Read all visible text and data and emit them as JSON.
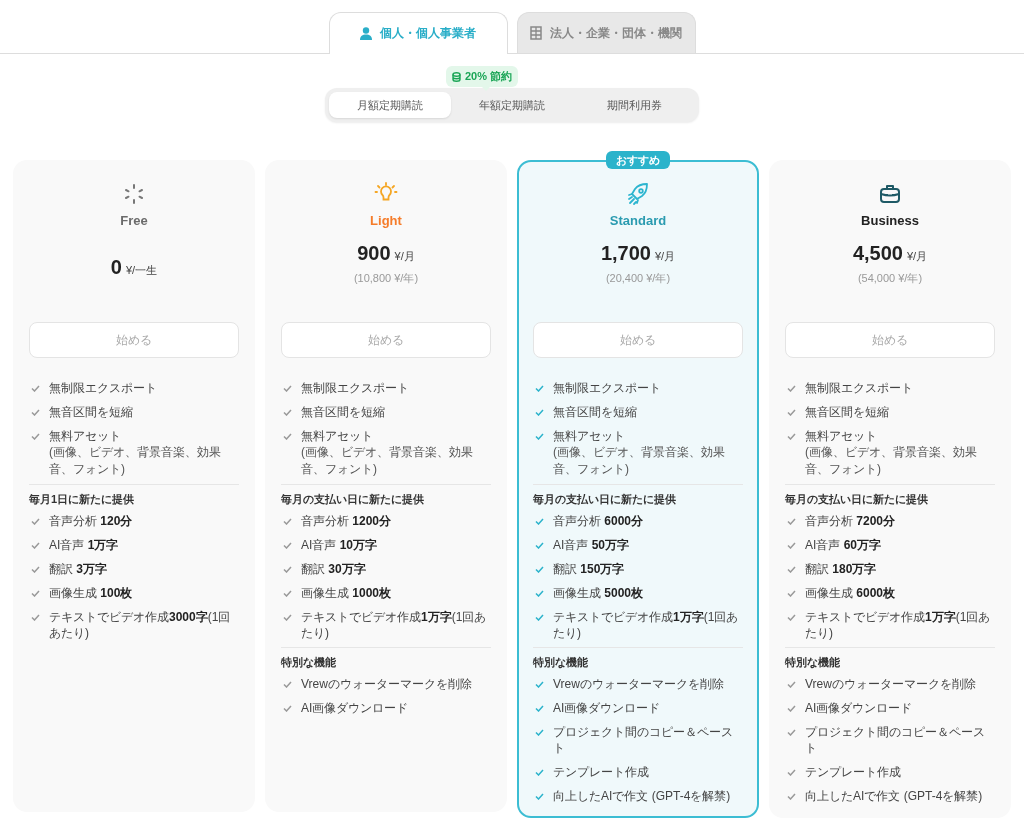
{
  "account_tabs": [
    {
      "label": "個人・個人事業者",
      "selected": true
    },
    {
      "label": "法人・企業・団体・機関",
      "selected": false
    }
  ],
  "billing": {
    "badge": "20% 節約",
    "options": [
      {
        "label": "月額定期購読",
        "selected": true
      },
      {
        "label": "年額定期購読",
        "selected": false
      },
      {
        "label": "期間利用券",
        "selected": false
      }
    ]
  },
  "plans": [
    {
      "name": "Free",
      "color": "#6b6b6b",
      "recommended": false,
      "price": "0",
      "unit": "¥/一生",
      "button": "始める",
      "sections": [
        {
          "features": [
            {
              "text": "無制限エクスポート"
            },
            {
              "text": "無音区間を短縮"
            },
            {
              "text": "無料アセット",
              "note": "(画像、ビデオ、背景音楽、効果音、フォント)"
            }
          ]
        },
        {
          "heading": "毎月1日に新たに提供",
          "features": [
            {
              "text": "音声分析 **120分**"
            },
            {
              "text": "AI音声 **1万字**"
            },
            {
              "text": "翻訳 **3万字**"
            },
            {
              "text": "画像生成 **100枚**"
            },
            {
              "text": "テキストでビデオ作成**3000字**(1回あたり)"
            }
          ]
        }
      ]
    },
    {
      "name": "Light",
      "color": "#f57c2a",
      "recommended": false,
      "price": "900",
      "unit": "¥/月",
      "yearly": "(10,800 ¥/年)",
      "button": "始める",
      "sections": [
        {
          "features": [
            {
              "text": "無制限エクスポート"
            },
            {
              "text": "無音区間を短縮"
            },
            {
              "text": "無料アセット",
              "note": "(画像、ビデオ、背景音楽、効果音、フォント)"
            }
          ]
        },
        {
          "heading": "毎月の支払い日に新たに提供",
          "features": [
            {
              "text": "音声分析 **1200分**"
            },
            {
              "text": "AI音声 **10万字**"
            },
            {
              "text": "翻訳 **30万字**"
            },
            {
              "text": "画像生成 **1000枚**"
            },
            {
              "text": "テキストでビデオ作成**1万字**(1回あたり)"
            }
          ]
        },
        {
          "heading": "特別な機能",
          "features": [
            {
              "text": "Vrewのウォーターマークを削除"
            },
            {
              "text": "AI画像ダウンロード"
            }
          ]
        }
      ]
    },
    {
      "name": "Standard",
      "color": "#2a9bb0",
      "recommended": true,
      "badge": "おすすめ",
      "price": "1,700",
      "unit": "¥/月",
      "yearly": "(20,400 ¥/年)",
      "button": "始める",
      "sections": [
        {
          "features": [
            {
              "text": "無制限エクスポート"
            },
            {
              "text": "無音区間を短縮"
            },
            {
              "text": "無料アセット",
              "note": "(画像、ビデオ、背景音楽、効果音、フォント)"
            }
          ]
        },
        {
          "heading": "毎月の支払い日に新たに提供",
          "features": [
            {
              "text": "音声分析 **6000分**"
            },
            {
              "text": "AI音声 **50万字**"
            },
            {
              "text": "翻訳 **150万字**"
            },
            {
              "text": "画像生成 **5000枚**"
            },
            {
              "text": "テキストでビデオ作成**1万字**(1回あたり)"
            }
          ]
        },
        {
          "heading": "特別な機能",
          "features": [
            {
              "text": "Vrewのウォーターマークを削除"
            },
            {
              "text": "AI画像ダウンロード"
            },
            {
              "text": "プロジェクト間のコピー＆ペースト"
            },
            {
              "text": "テンプレート作成"
            },
            {
              "text": "向上したAIで作文 (GPT-4を解禁)"
            }
          ]
        }
      ]
    },
    {
      "name": "Business",
      "color": "#222222",
      "recommended": false,
      "price": "4,500",
      "unit": "¥/月",
      "yearly": "(54,000 ¥/年)",
      "button": "始める",
      "sections": [
        {
          "features": [
            {
              "text": "無制限エクスポート"
            },
            {
              "text": "無音区間を短縮"
            },
            {
              "text": "無料アセット",
              "note": "(画像、ビデオ、背景音楽、効果音、フォント)"
            }
          ]
        },
        {
          "heading": "毎月の支払い日に新たに提供",
          "features": [
            {
              "text": "音声分析 **7200分**"
            },
            {
              "text": "AI音声 **60万字**"
            },
            {
              "text": "翻訳 **180万字**"
            },
            {
              "text": "画像生成 **6000枚**"
            },
            {
              "text": "テキストでビデオ作成**1万字**(1回あたり)"
            }
          ]
        },
        {
          "heading": "特別な機能",
          "features": [
            {
              "text": "Vrewのウォーターマークを削除"
            },
            {
              "text": "AI画像ダウンロード"
            },
            {
              "text": "プロジェクト間のコピー＆ペースト"
            },
            {
              "text": "テンプレート作成"
            },
            {
              "text": "向上したAIで作文 (GPT-4を解禁)"
            }
          ]
        }
      ]
    }
  ]
}
